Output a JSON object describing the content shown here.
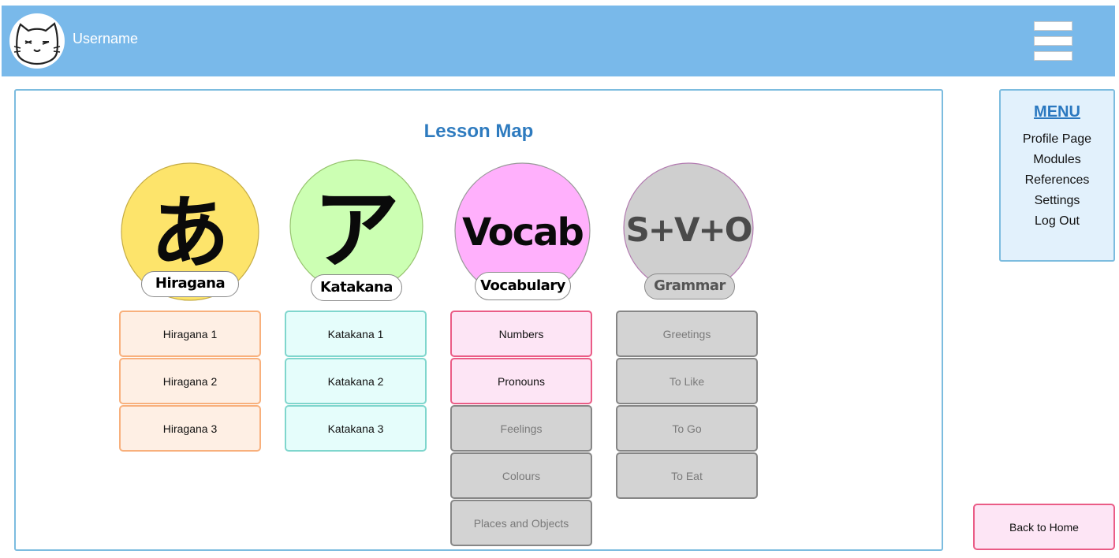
{
  "header": {
    "username": "Username",
    "avatar_icon": "cat-face-icon",
    "menu_icon": "hamburger-icon",
    "background_color": "#79b9ea"
  },
  "lesson_map": {
    "title": "Lesson Map",
    "modules": [
      {
        "name": "Hiragana",
        "glyph": "あ",
        "color": "#fde46b",
        "lessons": [
          {
            "label": "Hiragana 1",
            "locked": false
          },
          {
            "label": "Hiragana 2",
            "locked": false
          },
          {
            "label": "Hiragana 3",
            "locked": false
          }
        ]
      },
      {
        "name": "Katakana",
        "glyph": "ア",
        "color": "#ccffb3",
        "lessons": [
          {
            "label": "Katakana 1",
            "locked": false
          },
          {
            "label": "Katakana 2",
            "locked": false
          },
          {
            "label": "Katakana 3",
            "locked": false
          }
        ]
      },
      {
        "name": "Vocabulary",
        "glyph": "Vocab",
        "color": "#ffb0fc",
        "lessons": [
          {
            "label": "Numbers",
            "locked": false
          },
          {
            "label": "Pronouns",
            "locked": false
          },
          {
            "label": "Feelings",
            "locked": true
          },
          {
            "label": "Colours",
            "locked": true
          },
          {
            "label": "Places and Objects",
            "locked": true
          }
        ]
      },
      {
        "name": "Grammar",
        "glyph": "S+V+O",
        "color": "#cfcfcf",
        "lessons": [
          {
            "label": "Greetings",
            "locked": true
          },
          {
            "label": "To Like",
            "locked": true
          },
          {
            "label": "To Go",
            "locked": true
          },
          {
            "label": "To Eat",
            "locked": true
          }
        ]
      }
    ]
  },
  "menu": {
    "title": "MENU",
    "items": [
      "Profile Page",
      "Modules",
      "References",
      "Settings",
      "Log Out"
    ]
  },
  "back_button": {
    "label": "Back to Home"
  }
}
